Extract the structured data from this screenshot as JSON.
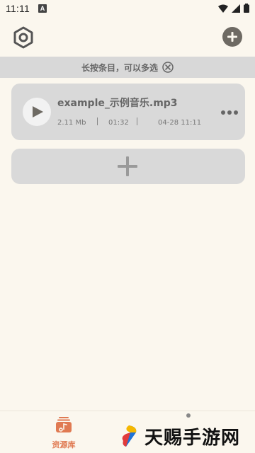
{
  "status_bar": {
    "time": "11:11",
    "badge": "A"
  },
  "hint": {
    "text": "长按条目，可以多选"
  },
  "track": {
    "title": "example_示例音乐.mp3",
    "size": "2.11 Mb",
    "duration": "01:32",
    "date": "04-28 11:11"
  },
  "bottom_nav": {
    "library_label": "资源库"
  },
  "watermark": {
    "text": "天赐手游网"
  },
  "colors": {
    "accent": "#e07a52",
    "background": "#fbf7ee",
    "card": "#d9d9d9"
  }
}
